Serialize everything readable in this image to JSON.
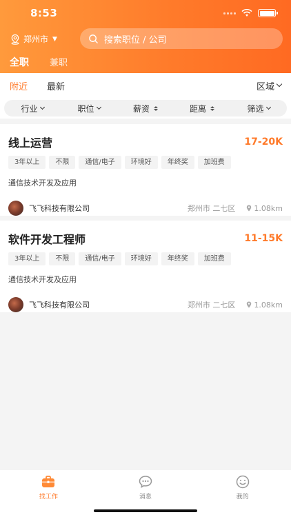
{
  "status": {
    "time": "8:53"
  },
  "header": {
    "city": "郑州市",
    "search_placeholder": "搜索职位 / 公司",
    "tabs": [
      {
        "label": "全职",
        "active": true
      },
      {
        "label": "兼职",
        "active": false
      }
    ]
  },
  "sortbar": {
    "items": [
      {
        "label": "附近",
        "active": true
      },
      {
        "label": "最新",
        "active": false
      }
    ],
    "region_label": "区域"
  },
  "filters": [
    {
      "label": "行业",
      "icon": "chevron-down-icon"
    },
    {
      "label": "职位",
      "icon": "chevron-down-icon"
    },
    {
      "label": "薪资",
      "icon": "sort-icon"
    },
    {
      "label": "距离",
      "icon": "sort-icon"
    },
    {
      "label": "筛选",
      "icon": "chevron-down-icon"
    }
  ],
  "jobs": [
    {
      "title": "线上运营",
      "salary": "17-20K",
      "tags": [
        "3年以上",
        "不限",
        "通信/电子",
        "环境好",
        "年终奖",
        "加班费"
      ],
      "desc": "通信技术开发及应用",
      "company": "飞飞科技有限公司",
      "location": "郑州市 二七区",
      "distance": "1.08km"
    },
    {
      "title": "软件开发工程师",
      "salary": "11-15K",
      "tags": [
        "3年以上",
        "不限",
        "通信/电子",
        "环境好",
        "年终奖",
        "加班费"
      ],
      "desc": "通信技术开发及应用",
      "company": "飞飞科技有限公司",
      "location": "郑州市 二七区",
      "distance": "1.08km"
    }
  ],
  "tabbar": [
    {
      "label": "找工作",
      "icon": "briefcase-icon",
      "active": true
    },
    {
      "label": "消息",
      "icon": "chat-icon",
      "active": false
    },
    {
      "label": "我的",
      "icon": "smiley-icon",
      "active": false
    }
  ],
  "colors": {
    "accent": "#ff7a2a",
    "header_start": "#ff9a3c",
    "header_end": "#ff6a22"
  }
}
